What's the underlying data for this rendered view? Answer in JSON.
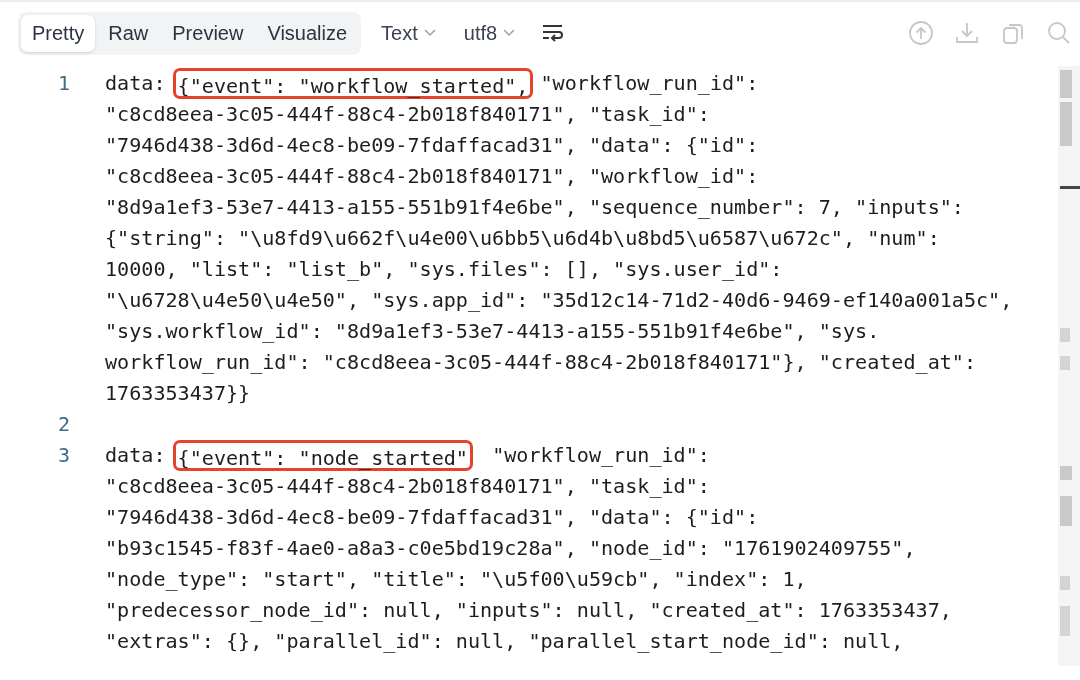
{
  "tabs": [
    {
      "label": "Pretty",
      "selected": true
    },
    {
      "label": "Raw",
      "selected": false
    },
    {
      "label": "Preview",
      "selected": false
    },
    {
      "label": "Visualize",
      "selected": false
    }
  ],
  "dropdowns": [
    {
      "label": "Text"
    },
    {
      "label": "utf8"
    }
  ],
  "lines": [
    {
      "number": "1",
      "prefix": "data: ",
      "boxed": "{\"event\": \"workflow_started\",",
      "rest": " \"workflow_run_id\":",
      "continuation": [
        "\"c8cd8eea-3c05-444f-88c4-2b018f840171\", \"task_id\":",
        "\"7946d438-3d6d-4ec8-be09-7fdaffacad31\", \"data\": {\"id\":",
        "\"c8cd8eea-3c05-444f-88c4-2b018f840171\", \"workflow_id\":",
        "\"8d9a1ef3-53e7-4413-a155-551b91f4e6be\", \"sequence_number\": 7, \"inputs\":",
        "{\"string\": \"\\u8fd9\\u662f\\u4e00\\u6bb5\\u6d4b\\u8bd5\\u6587\\u672c\", \"num\":",
        "10000, \"list\": \"list_b\", \"sys.files\": [], \"sys.user_id\":",
        "\"\\u6728\\u4e50\\u4e50\", \"sys.app_id\": \"35d12c14-71d2-40d6-9469-ef140a001a5c\",",
        "\"sys.workflow_id\": \"8d9a1ef3-53e7-4413-a155-551b91f4e6be\", \"sys.",
        "workflow_run_id\": \"c8cd8eea-3c05-444f-88c4-2b018f840171\"}, \"created_at\":",
        "1763353437}}"
      ]
    },
    {
      "number": "2"
    },
    {
      "number": "3",
      "prefix": "data: ",
      "boxed": "{\"event\": \"node_started\"",
      "rest": "  \"workflow_run_id\":",
      "continuation": [
        "\"c8cd8eea-3c05-444f-88c4-2b018f840171\", \"task_id\":",
        "\"7946d438-3d6d-4ec8-be09-7fdaffacad31\", \"data\": {\"id\":",
        "\"b93c1545-f83f-4ae0-a8a3-c0e5bd19c28a\", \"node_id\": \"1761902409755\",",
        "\"node_type\": \"start\", \"title\": \"\\u5f00\\u59cb\", \"index\": 1,",
        "\"predecessor_node_id\": null, \"inputs\": null, \"created_at\": 1763353437,",
        "\"extras\": {}, \"parallel_id\": null, \"parallel_start_node_id\": null,"
      ]
    }
  ]
}
